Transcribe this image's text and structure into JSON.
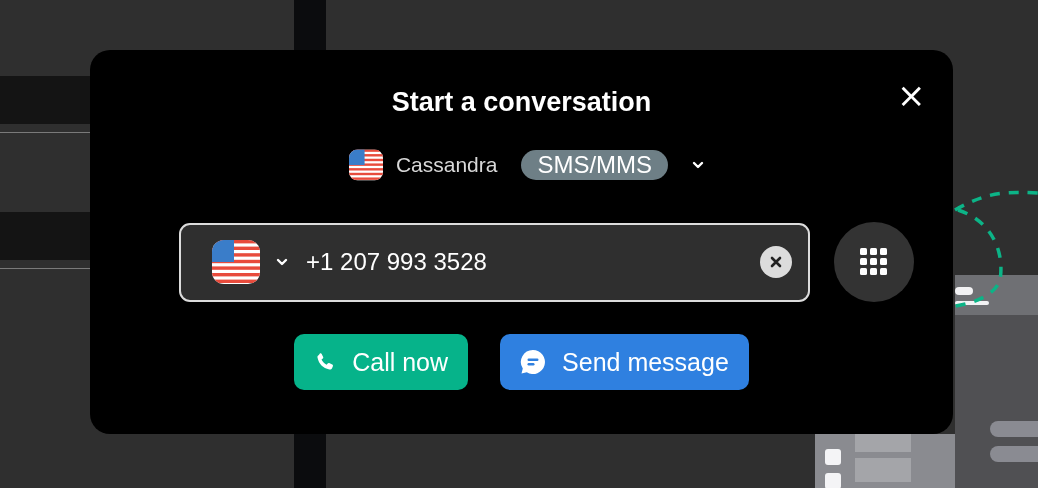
{
  "dialog": {
    "title": "Start a conversation",
    "close_label": "×"
  },
  "sender": {
    "name": "Cassandra",
    "channel": "SMS/MMS"
  },
  "phone_field": {
    "value": "+1 207 993 3528"
  },
  "buttons": [
    {
      "kind": "call",
      "label": "Call now"
    },
    {
      "kind": "message",
      "label": "Send message"
    }
  ]
}
